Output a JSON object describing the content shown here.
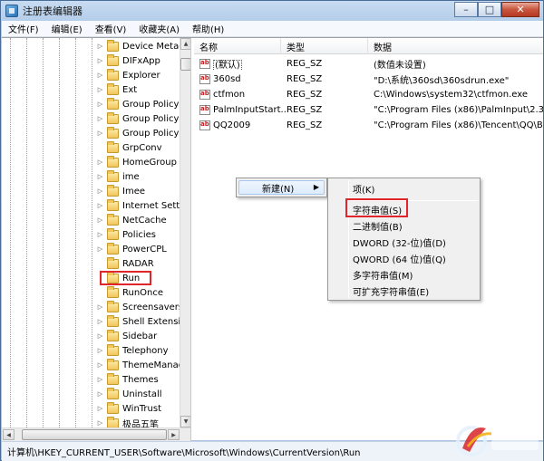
{
  "window": {
    "title": "注册表编辑器",
    "minimize": "–",
    "maximize": "□",
    "close": "✕"
  },
  "menubar": {
    "file": "文件(F)",
    "edit": "编辑(E)",
    "view": "查看(V)",
    "favorites": "收藏夹(A)",
    "help": "帮助(H)"
  },
  "tree": {
    "items": [
      {
        "label": "Device Metac"
      },
      {
        "label": "DIFxApp"
      },
      {
        "label": "Explorer"
      },
      {
        "label": "Ext"
      },
      {
        "label": "Group Policy"
      },
      {
        "label": "Group Policy"
      },
      {
        "label": "Group Policy"
      },
      {
        "label": "GrpConv"
      },
      {
        "label": "HomeGroup"
      },
      {
        "label": "ime"
      },
      {
        "label": "Imee"
      },
      {
        "label": "Internet Settir"
      },
      {
        "label": "NetCache"
      },
      {
        "label": "Policies"
      },
      {
        "label": "PowerCPL"
      },
      {
        "label": "RADAR"
      },
      {
        "label": "Run"
      },
      {
        "label": "RunOnce"
      },
      {
        "label": "Screensavers"
      },
      {
        "label": "Shell Extensic"
      },
      {
        "label": "Sidebar"
      },
      {
        "label": "Telephony"
      },
      {
        "label": "ThemeManag"
      },
      {
        "label": "Themes"
      },
      {
        "label": "Uninstall"
      },
      {
        "label": "WinTrust"
      },
      {
        "label": "极品五笔"
      }
    ]
  },
  "list": {
    "columns": {
      "name": "名称",
      "type": "类型",
      "data": "数据"
    },
    "rows": [
      {
        "name": "(默认)",
        "type": "REG_SZ",
        "data": "(数值未设置)"
      },
      {
        "name": "360sd",
        "type": "REG_SZ",
        "data": "\"D:\\系统\\360sd\\360sdrun.exe\""
      },
      {
        "name": "ctfmon",
        "type": "REG_SZ",
        "data": "C:\\Windows\\system32\\ctfmon.exe"
      },
      {
        "name": "PalmInputStart...",
        "type": "REG_SZ",
        "data": "\"C:\\Program Files (x86)\\PalmInput\\2.3.0"
      },
      {
        "name": "QQ2009",
        "type": "REG_SZ",
        "data": "\"C:\\Program Files (x86)\\Tencent\\QQ\\Bi"
      }
    ]
  },
  "context_menu": {
    "new_label": "新建(N)",
    "arrow": "▶"
  },
  "submenu": {
    "key": "项(K)",
    "string_value": "字符串值(S)",
    "binary_value": "二进制值(B)",
    "dword_value": "DWORD (32-位)值(D)",
    "qword_value": "QWORD (64 位)值(Q)",
    "multi_string_value": "多字符串值(M)",
    "expandable_string_value": "可扩充字符串值(E)"
  },
  "statusbar": {
    "path": "计算机\\HKEY_CURRENT_USER\\Software\\Microsoft\\Windows\\CurrentVersion\\Run"
  },
  "colors": {
    "highlight_box": "#e0262a",
    "folder": "#f2c55b",
    "titlebar": "#b4cde9"
  }
}
